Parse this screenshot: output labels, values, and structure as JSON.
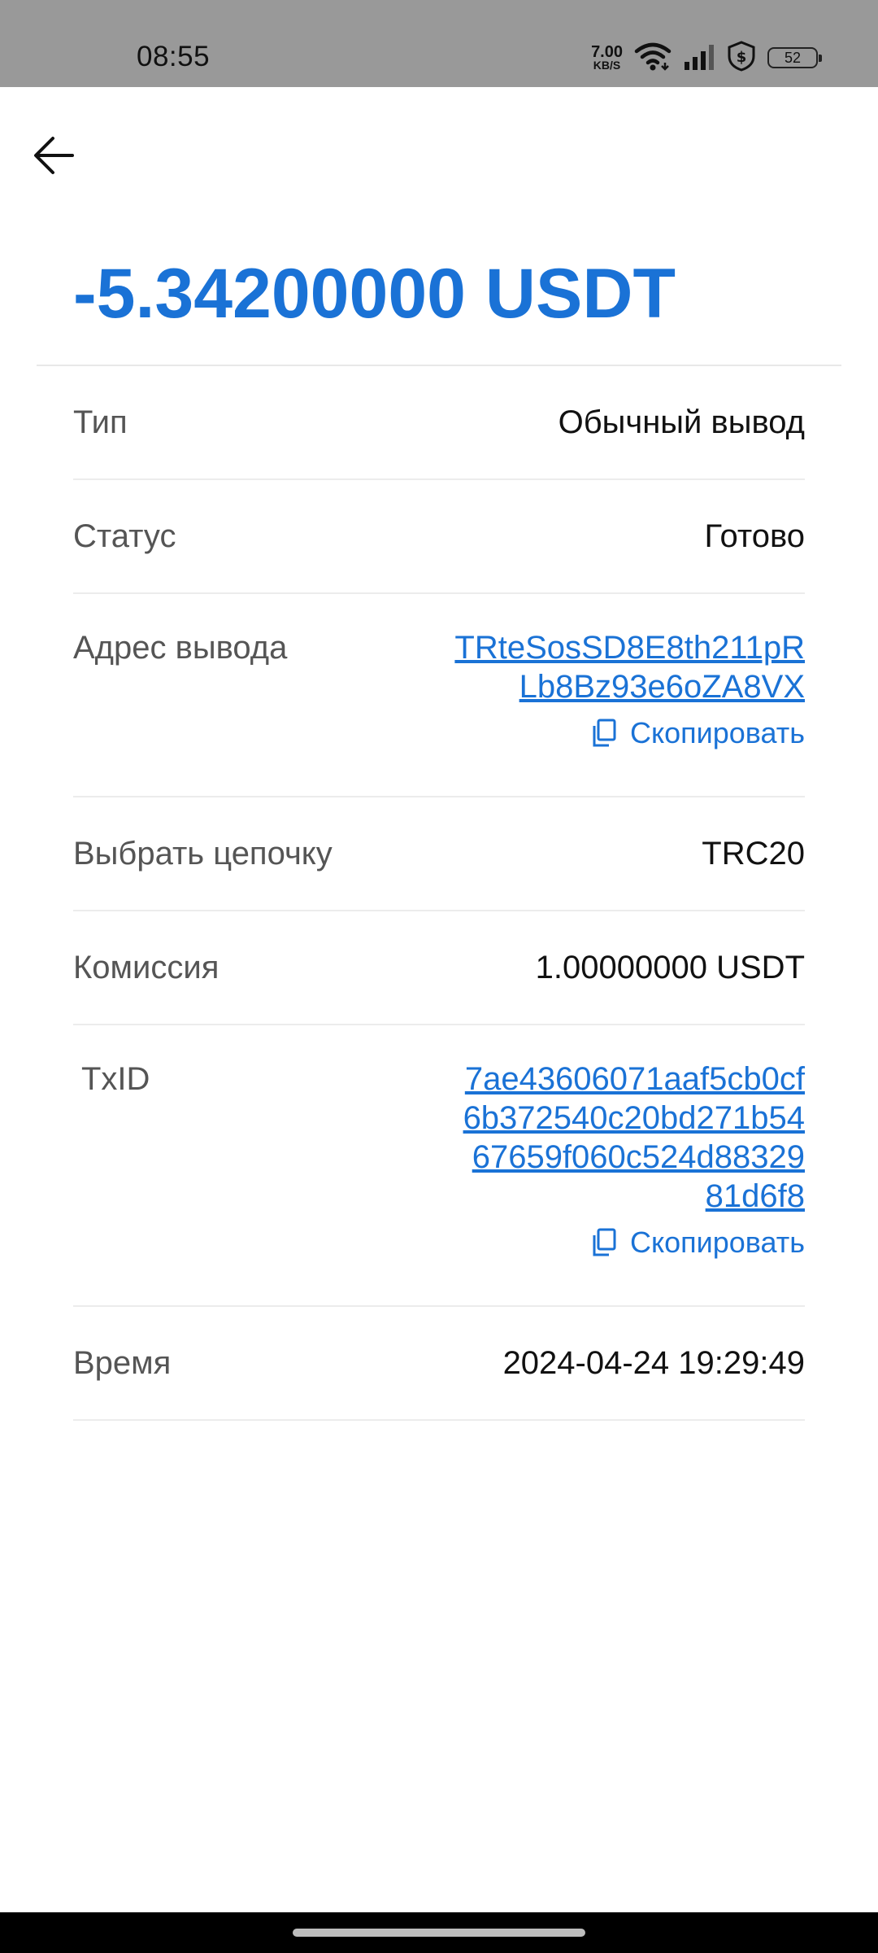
{
  "status_bar": {
    "time": "08:55",
    "speed_value": "7.00",
    "speed_unit": "KB/S",
    "battery": "52"
  },
  "header": {
    "back_icon": "arrow-left-icon"
  },
  "transaction": {
    "amount": "-5.34200000 USDT",
    "amount_color": "#1a72d6"
  },
  "details": {
    "type": {
      "label": "Тип",
      "value": "Обычный вывод"
    },
    "status": {
      "label": "Статус",
      "value": "Готово"
    },
    "address": {
      "label": "Адрес вывода",
      "line1": "TRteSosSD8E8th211pR",
      "line2": "Lb8Bz93e6oZA8VX",
      "copy_label": "Скопировать"
    },
    "chain": {
      "label": "Выбрать цепочку",
      "value": "TRC20"
    },
    "fee": {
      "label": "Комиссия",
      "value": "1.00000000 USDT"
    },
    "txid": {
      "label": "TxID",
      "line1": "7ae43606071aaf5cb0cf",
      "line2": "6b372540c20bd271b54",
      "line3": "67659f060c524d88329",
      "line4": "81d6f8",
      "copy_label": "Скопировать"
    },
    "time": {
      "label": "Время",
      "value": "2024-04-24 19:29:49"
    }
  }
}
